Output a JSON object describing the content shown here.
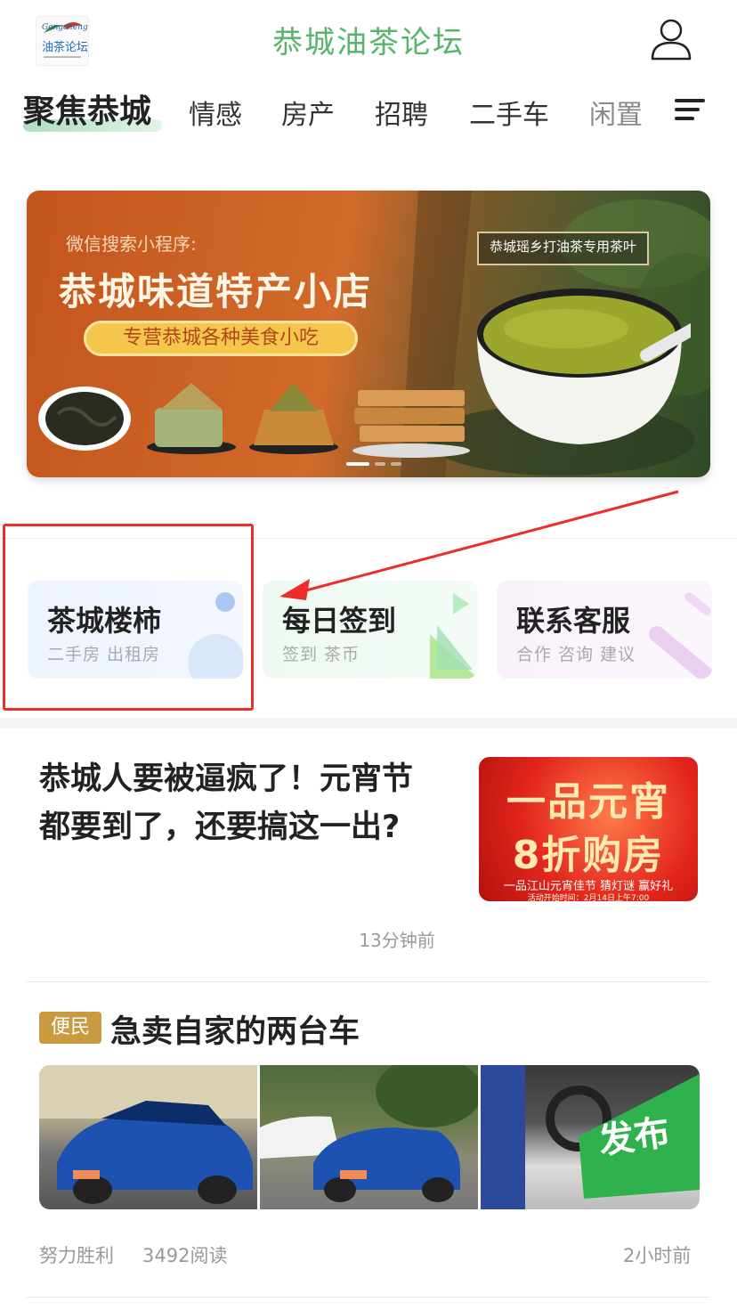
{
  "header": {
    "title": "恭城油茶论坛",
    "logo_text": "油茶论坛"
  },
  "nav": {
    "active": "聚焦恭城",
    "items": [
      "情感",
      "房产",
      "招聘",
      "二手车",
      "闲置"
    ]
  },
  "banner": {
    "subtitle": "微信搜索小程序:",
    "title": "恭城味道特产小店",
    "pill": "专营恭城各种美食小吃",
    "tag": "恭城瑶乡打油茶专用茶叶"
  },
  "quick_links": [
    {
      "title": "茶城楼柿",
      "sub": "二手房 出租房"
    },
    {
      "title": "每日签到",
      "sub": "签到 茶币"
    },
    {
      "title": "联系客服",
      "sub": "合作 咨询 建议"
    }
  ],
  "article1": {
    "title": "恭城人要被逼疯了！元宵节都要到了，还要搞这一出?",
    "time": "13分钟前",
    "thumb_line1": "一品元宵",
    "thumb_line2": "8折购房",
    "thumb_caption": "一品江山元宵佳节 猜灯谜 赢好礼",
    "thumb_small": "活动开始时间：2月14日上午7:00"
  },
  "article2": {
    "tag": "便民",
    "title": "急卖自家的两台车",
    "publish_badge": "发布",
    "author": "努力胜利",
    "reads": "3492阅读",
    "time": "2小时前"
  },
  "colors": {
    "brand_green": "#58b36b",
    "highlight_red": "#ef2b2b",
    "tag_gold": "#c99a3f"
  }
}
